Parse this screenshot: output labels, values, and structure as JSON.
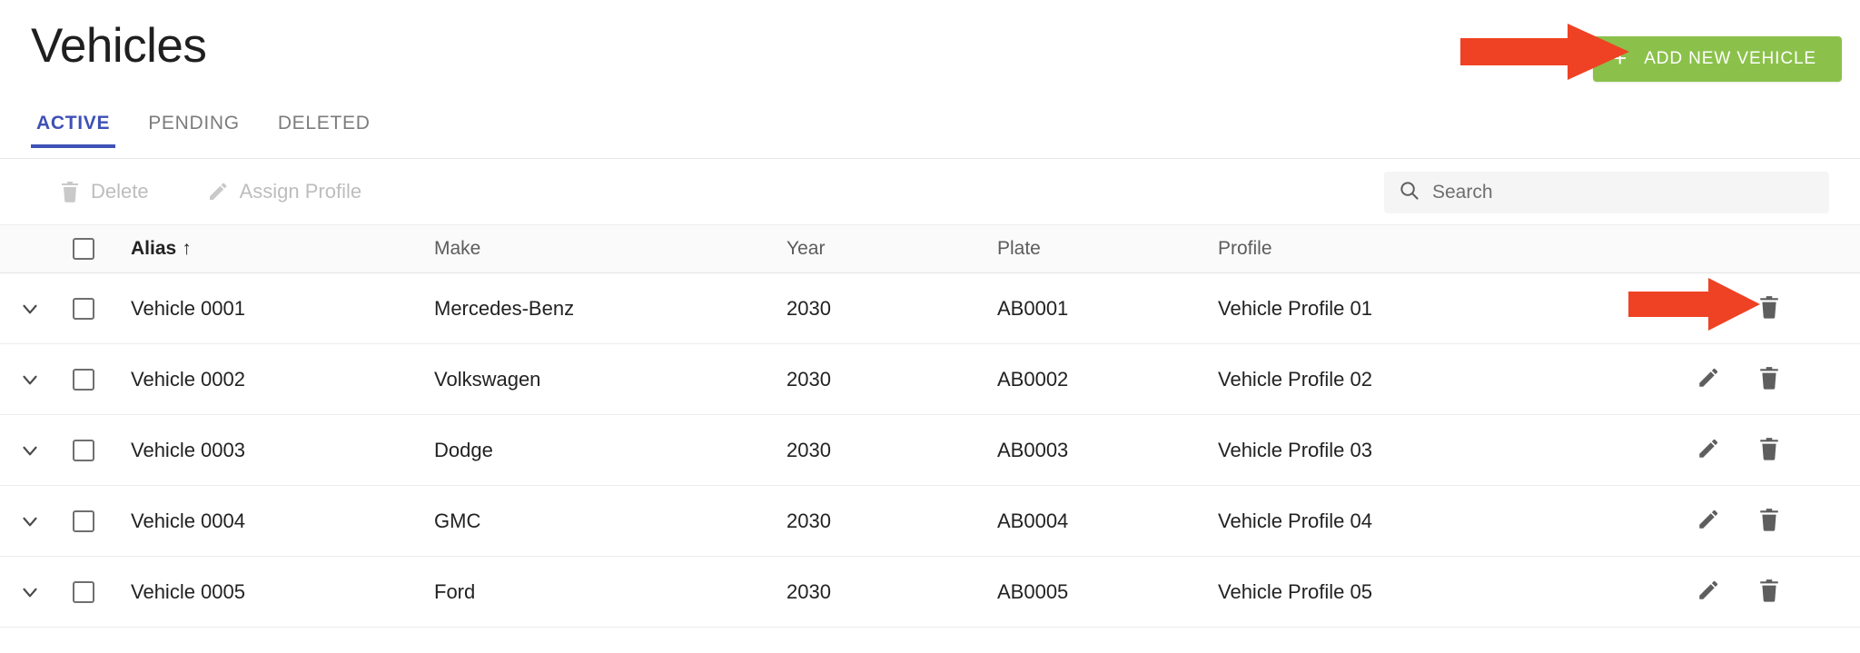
{
  "header": {
    "title": "Vehicles",
    "add_button": {
      "label": "ADD NEW VEHICLE",
      "plus": "+",
      "color": "#8bc14a"
    }
  },
  "tabs": [
    {
      "label": "ACTIVE",
      "active": true
    },
    {
      "label": "PENDING",
      "active": false
    },
    {
      "label": "DELETED",
      "active": false
    }
  ],
  "tab_accent_color": "#3f51b5",
  "toolbar": {
    "delete_label": "Delete",
    "assign_profile_label": "Assign Profile",
    "disabled_color": "#bdbdbd"
  },
  "search": {
    "placeholder": "Search",
    "value": ""
  },
  "table": {
    "columns": [
      {
        "key": "alias",
        "label": "Alias",
        "sorted": true,
        "sort_dir": "↑"
      },
      {
        "key": "make",
        "label": "Make",
        "sorted": false
      },
      {
        "key": "year",
        "label": "Year",
        "sorted": false
      },
      {
        "key": "plate",
        "label": "Plate",
        "sorted": false
      },
      {
        "key": "profile",
        "label": "Profile",
        "sorted": false
      }
    ],
    "select_all_checked": false,
    "rows": [
      {
        "alias": "Vehicle 0001",
        "make": "Mercedes-Benz",
        "year": "2030",
        "plate": "AB0001",
        "profile": "Vehicle Profile 01",
        "checked": false
      },
      {
        "alias": "Vehicle 0002",
        "make": "Volkswagen",
        "year": "2030",
        "plate": "AB0002",
        "profile": "Vehicle Profile 02",
        "checked": false
      },
      {
        "alias": "Vehicle 0003",
        "make": "Dodge",
        "year": "2030",
        "plate": "AB0003",
        "profile": "Vehicle Profile 03",
        "checked": false
      },
      {
        "alias": "Vehicle 0004",
        "make": "GMC",
        "year": "2030",
        "plate": "AB0004",
        "profile": "Vehicle Profile 04",
        "checked": false
      },
      {
        "alias": "Vehicle 0005",
        "make": "Ford",
        "year": "2030",
        "plate": "AB0005",
        "profile": "Vehicle Profile 05",
        "checked": false
      }
    ]
  },
  "annotations": {
    "color": "#ef4224",
    "arrows": [
      {
        "name": "arrow-pointing-to-add-new-vehicle-button",
        "target": "add-new-vehicle-button"
      },
      {
        "name": "arrow-pointing-to-edit-row-button",
        "target": "row-edit-button"
      }
    ]
  },
  "icons": {
    "trash": "trash-icon",
    "pencil": "pencil-icon",
    "search": "search-icon",
    "chevron_down": "chevron-down-icon",
    "sort_asc": "sort-ascending-arrow-icon",
    "plus": "plus-icon"
  }
}
